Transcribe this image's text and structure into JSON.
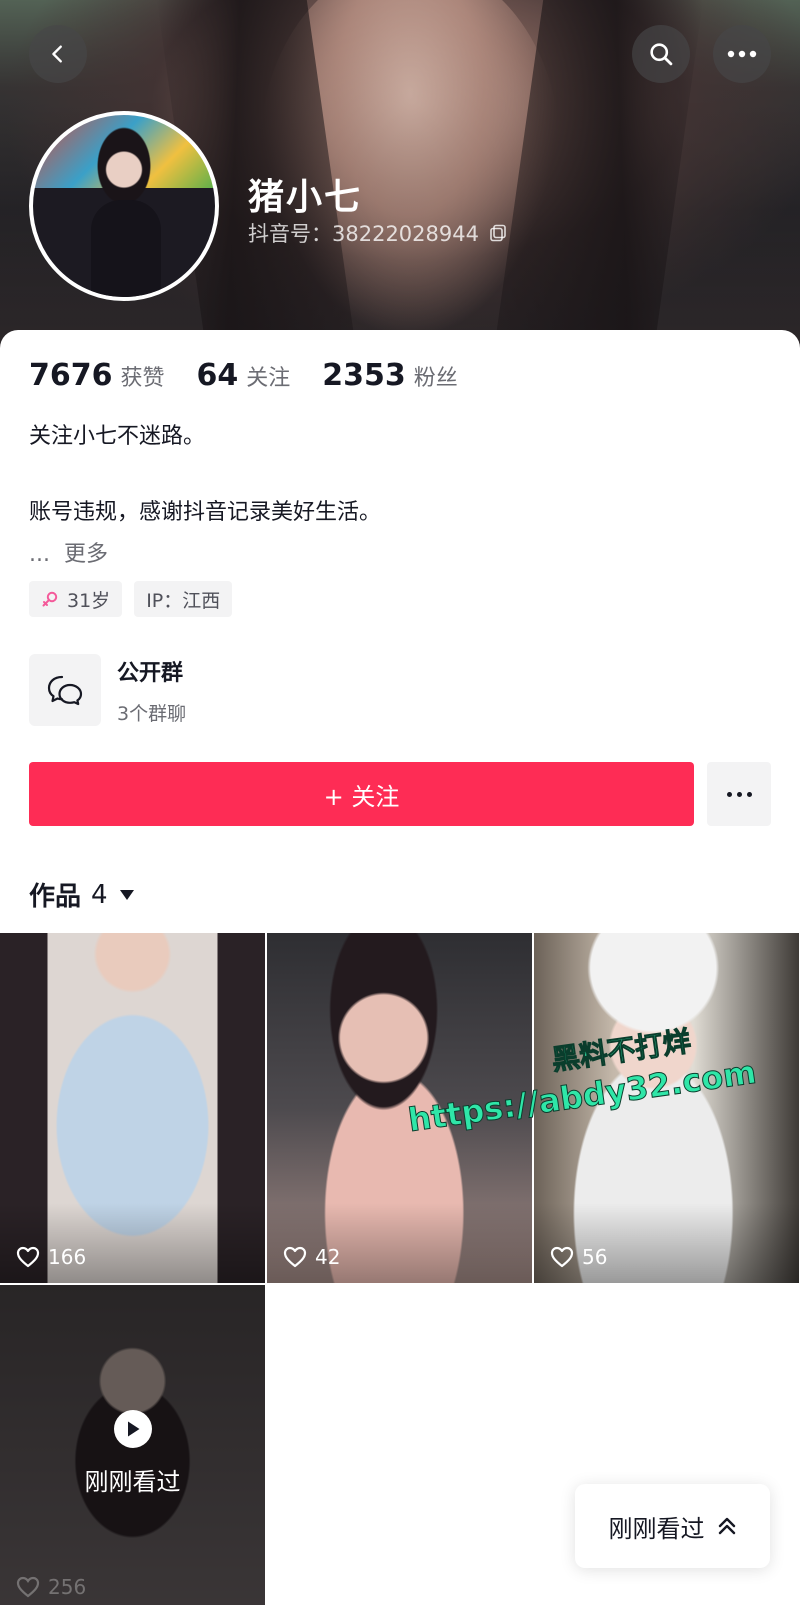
{
  "profile": {
    "name": "猪小七",
    "douyin_id": "抖音号：38222028944"
  },
  "stats": [
    {
      "value": "7676",
      "label": "获赞"
    },
    {
      "value": "64",
      "label": "关注"
    },
    {
      "value": "2353",
      "label": "粉丝"
    }
  ],
  "bio": {
    "line1": "关注小七不迷路。",
    "line2": "账号违规，感谢抖音记录美好生活。",
    "ellipsis": "...",
    "more": "更多"
  },
  "tags": {
    "age": "31岁",
    "ip": "IP：江西"
  },
  "group": {
    "title": "公开群",
    "subtitle": "3个群聊"
  },
  "follow_button": "+ 关注",
  "works": {
    "label": "作品",
    "count": "4"
  },
  "videos": [
    {
      "likes": "166"
    },
    {
      "likes": "42"
    },
    {
      "likes": "56"
    },
    {
      "likes": "256",
      "overlay": "刚刚看过"
    }
  ],
  "watermark": {
    "line1": "黑料不打烊",
    "line2": "https://abdy32.com"
  },
  "float_button": "刚刚看过",
  "colors": {
    "accent": "#fe2c55",
    "female": "#f45a9a",
    "watermark": "#2fe6a8"
  },
  "icons": [
    "back-icon",
    "search-icon",
    "more-icon",
    "copy-icon",
    "female-icon",
    "chat-group-icon",
    "heart-icon",
    "play-icon",
    "double-chevron-up-icon"
  ]
}
